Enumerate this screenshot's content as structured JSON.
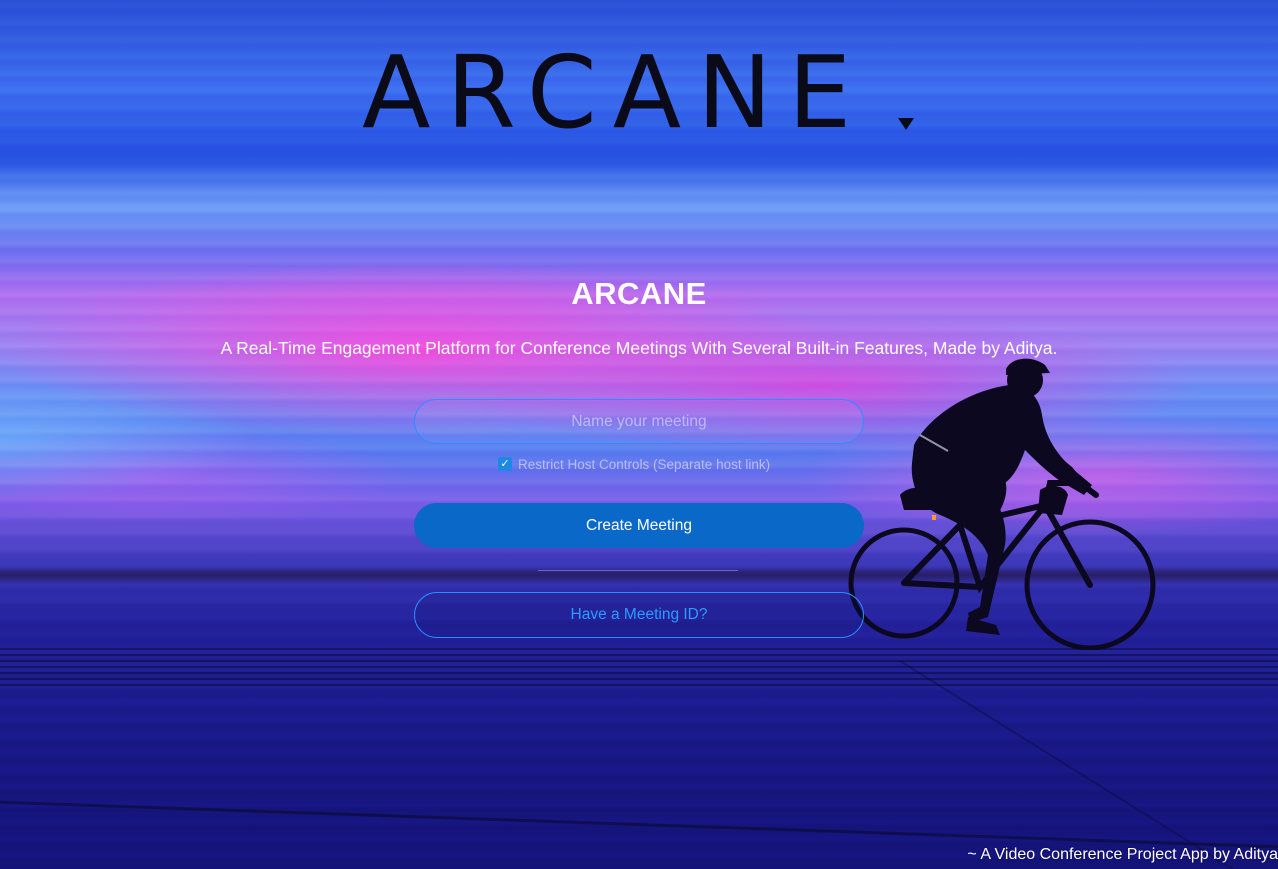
{
  "logo": {
    "text": "ARCANE"
  },
  "hero": {
    "title": "ARCANE",
    "tagline": "A Real-Time Engagement Platform for Conference Meetings With Several Built-in Features, Made by Aditya."
  },
  "form": {
    "meeting_name_placeholder": "Name your meeting",
    "meeting_name_value": "",
    "restrict_checkbox_checked": true,
    "restrict_label": "Restrict Host Controls (Separate host link)",
    "create_label": "Create Meeting",
    "join_label": "Have a Meeting ID?"
  },
  "footer": {
    "credit": "~ A Video Conference Project App by Aditya"
  },
  "colors": {
    "primary_button": "#0968c8",
    "outline_accent": "#2a8cff",
    "checkbox": "#1e88e5"
  },
  "icons": {
    "checkbox_check": "check-icon",
    "logo_mark": "triangle-icon"
  }
}
